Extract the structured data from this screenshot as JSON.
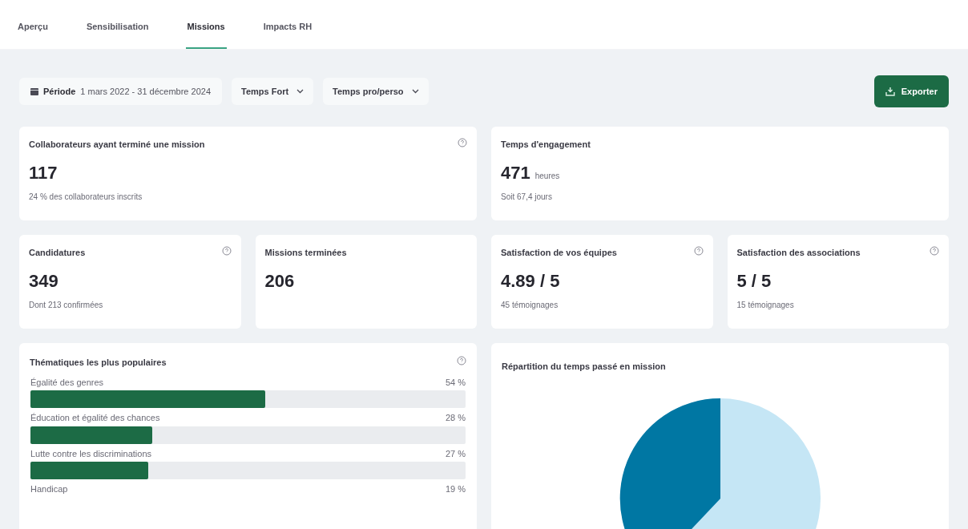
{
  "tabs": [
    {
      "label": "Aperçu",
      "selected": false
    },
    {
      "label": "Sensibilisation",
      "selected": false
    },
    {
      "label": "Missions",
      "selected": true
    },
    {
      "label": "Impacts RH",
      "selected": false
    }
  ],
  "filters": {
    "period_label": "Période",
    "period_value": "1 mars 2022 - 31 décembre 2024",
    "dropdowns": [
      "Temps Fort",
      "Temps pro/perso"
    ],
    "export_button": "Exporter"
  },
  "stat_rows": [
    [
      {
        "title": "Collaborateurs ayant terminé une mission",
        "value": "117",
        "subtitle": "24 % des collaborateurs inscrits",
        "help": true
      },
      {
        "title": "Temps d'engagement",
        "value": "471",
        "unit": "heures",
        "subtitle": "Soit 67,4 jours",
        "help": false
      }
    ],
    [
      {
        "title": "Candidatures",
        "value": "349",
        "subtitle": "Dont 213 confirmées",
        "help": true
      },
      {
        "title": "Missions terminées",
        "value": "206",
        "help": false
      },
      {
        "title": "Satisfaction de vos équipes",
        "value": "4.89 / 5",
        "subtitle": "45 témoignages",
        "help": true
      },
      {
        "title": "Satisfaction des associations",
        "value": "5 / 5",
        "subtitle": "15 témoignages",
        "help": true
      }
    ]
  ],
  "themes": {
    "title": "Thématiques les plus populaires",
    "help": true,
    "items": [
      {
        "label": "Égalité des genres",
        "reading": "54 %",
        "level": 0.54
      },
      {
        "label": "Éducation et égalité des chances",
        "reading": "28 %",
        "level": 0.28
      },
      {
        "label": "Lutte contre les discriminations",
        "reading": "27 %",
        "level": 0.27
      },
      {
        "label": "Handicap",
        "reading": "19 %"
      }
    ]
  },
  "time_split": {
    "title": "Répartition du temps passé en mission"
  }
}
